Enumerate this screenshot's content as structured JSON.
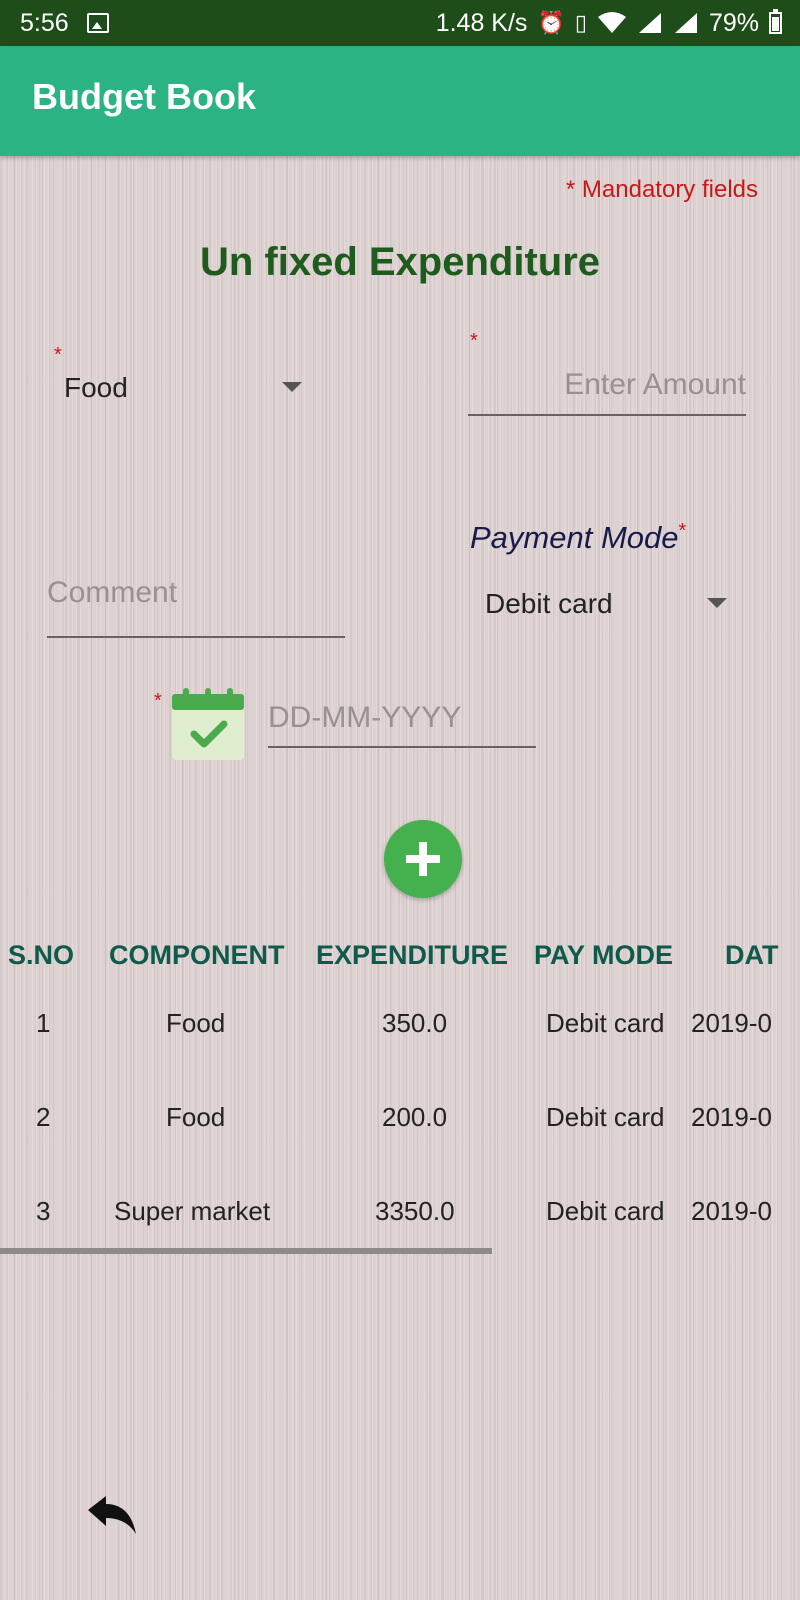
{
  "status_bar": {
    "time": "5:56",
    "network_speed": "1.48 K/s",
    "battery": "79%",
    "icons": [
      "image-icon",
      "alarm-icon",
      "vibrate-icon",
      "wifi-icon",
      "signal-icon",
      "battery-icon"
    ]
  },
  "app_bar": {
    "title": "Budget Book",
    "color": "#2bb384"
  },
  "form": {
    "mandatory_note": "* Mandatory fields",
    "heading": "Un fixed Expenditure",
    "required_mark": "*",
    "category": {
      "selected": "Food"
    },
    "amount": {
      "value": "",
      "placeholder": "Enter Amount"
    },
    "comment": {
      "value": "",
      "placeholder": "Comment"
    },
    "payment_mode": {
      "label": "Payment Mode",
      "selected": "Debit card"
    },
    "date": {
      "value": "",
      "placeholder": "DD-MM-YYYY"
    }
  },
  "table": {
    "headers": [
      "S.NO",
      "COMPONENT",
      "EXPENDITURE",
      "PAY MODE",
      "DAT"
    ],
    "rows": [
      [
        "1",
        "Food",
        "350.0",
        "Debit card",
        "2019-0"
      ],
      [
        "2",
        "Food",
        "200.0",
        "Debit card",
        "2019-0"
      ],
      [
        "3",
        "Super market",
        "3350.0",
        "Debit card",
        "2019-0"
      ]
    ]
  },
  "colors": {
    "accent": "#2bb384",
    "heading": "#1f5b1c",
    "required": "#c81818",
    "table_header": "#0f5a4a",
    "add_button": "#44b14e"
  }
}
